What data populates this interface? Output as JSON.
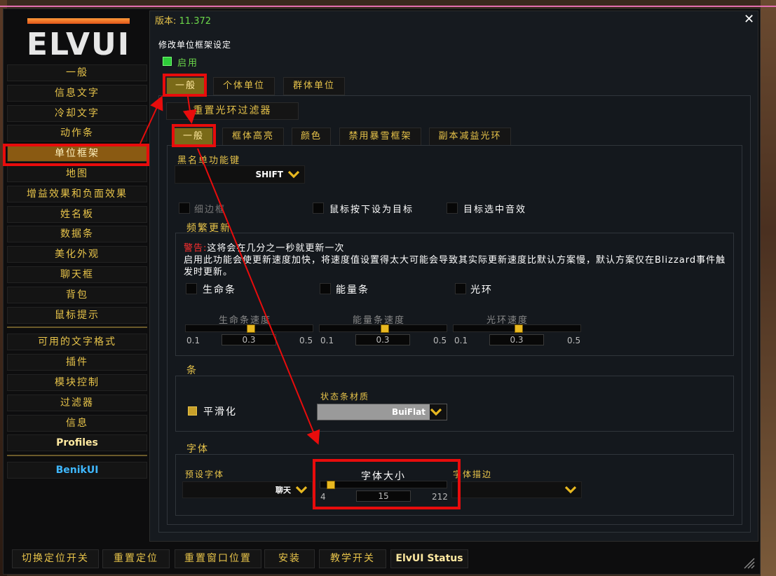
{
  "window": {
    "version_label": "版本: ",
    "version_number": "11.372",
    "close_label": "✕",
    "logo_text": "ELVUI"
  },
  "sidebar": {
    "items": [
      "一般",
      "信息文字",
      "冷却文字",
      "动作条",
      "单位框架",
      "地图",
      "增益效果和负面效果",
      "姓名板",
      "数据条",
      "美化外观",
      "聊天框",
      "背包",
      "鼠标提示"
    ],
    "selected_index": 4,
    "items2": [
      "可用的文字格式",
      "插件",
      "模块控制",
      "过滤器",
      "信息",
      "Profiles"
    ],
    "plugin": "BenikUI"
  },
  "main": {
    "title": "修改单位框架设定",
    "enable_label": "启用",
    "tabs": [
      "一般",
      "个体单位",
      "群体单位"
    ],
    "reset_aura_filter": "重置光环过滤器",
    "subtabs": [
      "一般",
      "框体高亮",
      "颜色",
      "禁用暴雪框架",
      "副本减益光环"
    ],
    "blacklist_label": "黑名单功能键",
    "blacklist_value": "SHIFT",
    "checks": [
      "细边框",
      "鼠标按下设为目标",
      "目标选中音效"
    ],
    "frequent": {
      "title": "频繁更新",
      "warn_prefix": "警告:",
      "warn_text": "这将会在几分之一秒就更新一次",
      "desc": "启用此功能会使更新速度加快，将速度值设置得太大可能会导致其实际更新速度比默认方案慢，默认方案仅在Blizzard事件触发时更新。",
      "checks": [
        "生命条",
        "能量条",
        "光环"
      ],
      "sliders": [
        {
          "label": "生命条速度",
          "min": "0.1",
          "value": "0.3",
          "max": "0.5",
          "fraction": 0.5
        },
        {
          "label": "能量条速度",
          "min": "0.1",
          "value": "0.3",
          "max": "0.5",
          "fraction": 0.5
        },
        {
          "label": "光环速度",
          "min": "0.1",
          "value": "0.3",
          "max": "0.5",
          "fraction": 0.5
        }
      ]
    },
    "bars": {
      "title": "条",
      "smooth_label": "平滑化",
      "statusbar_label": "状态条材质",
      "statusbar_value": "BuiFlat"
    },
    "font": {
      "title": "字体",
      "default_font_label": "预设字体",
      "default_font_value": "聊天",
      "size_label": "字体大小",
      "size_min": "4",
      "size_value": "15",
      "size_max": "212",
      "size_fraction": 0.053,
      "outline_label": "字体描边"
    }
  },
  "bottom": [
    "切换定位开关",
    "重置定位",
    "重置窗口位置",
    "安装",
    "教学开关",
    "ElvUI Status"
  ],
  "colors": {
    "accent": "#e8c44a",
    "selected": "#8a5a12",
    "highlight": "#e80c0c"
  }
}
